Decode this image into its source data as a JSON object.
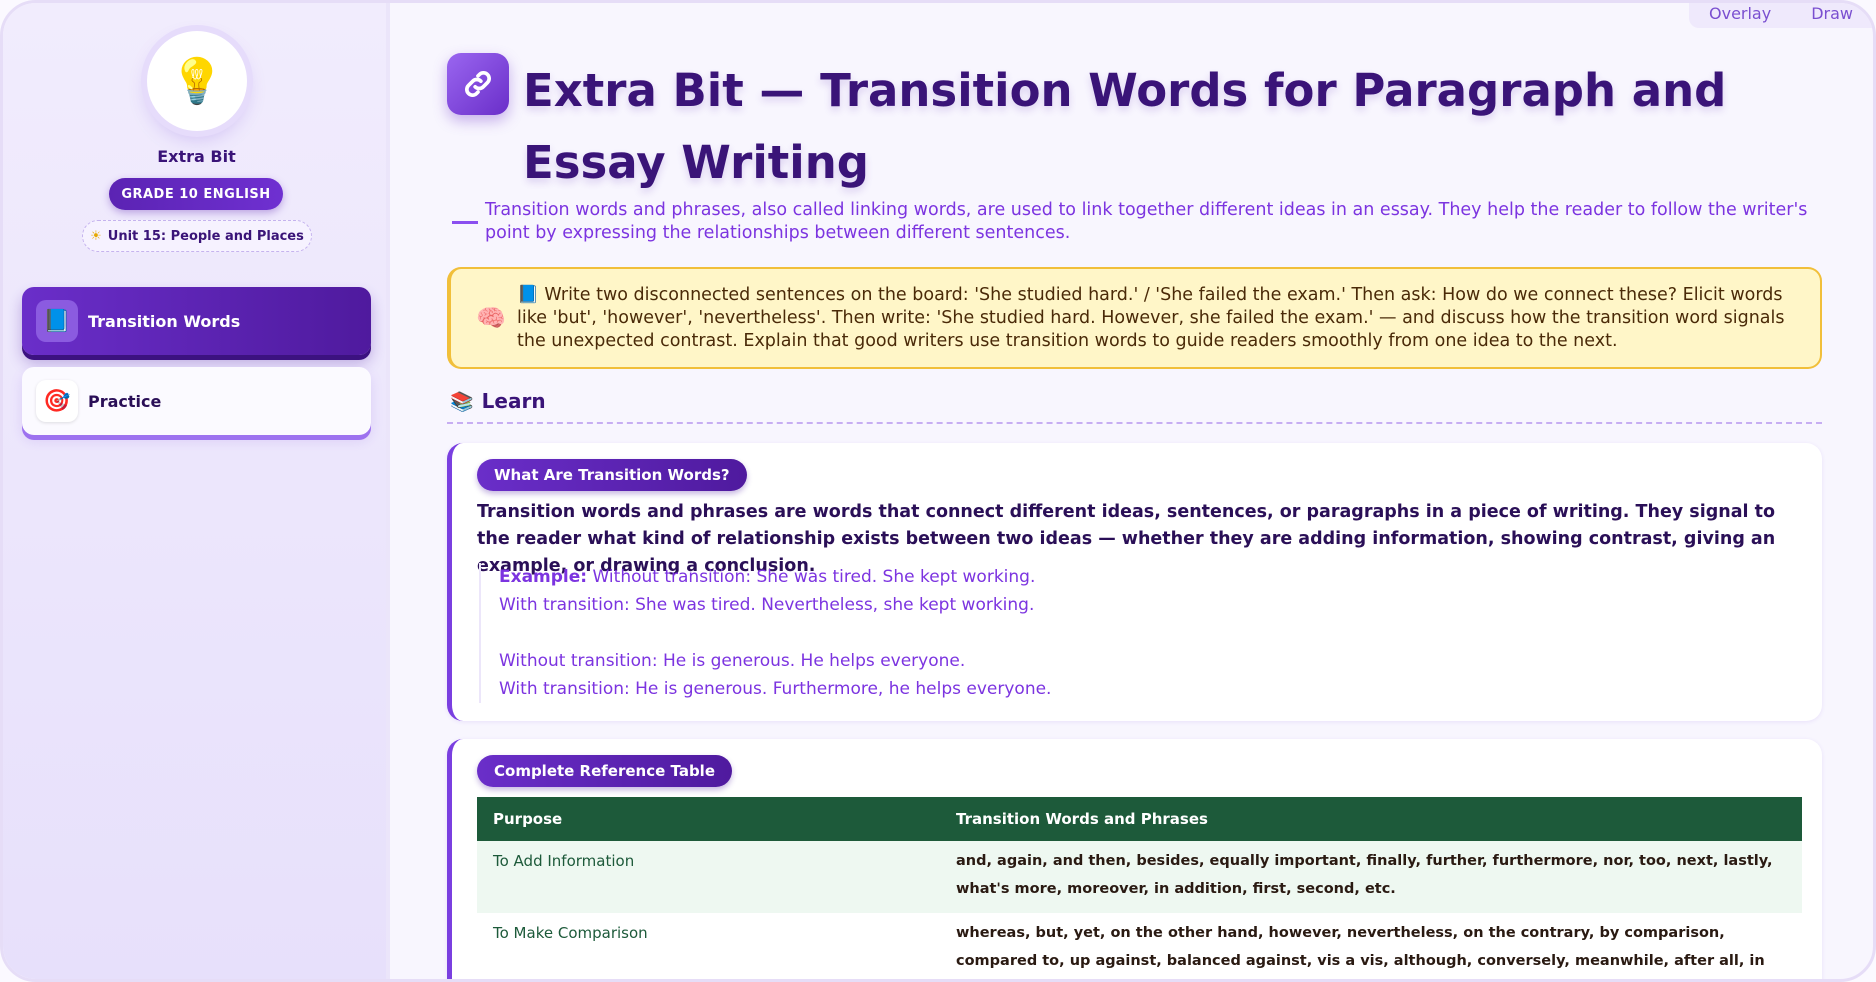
{
  "tools": {
    "overlay_label": "Overlay",
    "draw_label": "Draw"
  },
  "sidebar": {
    "logo_icon": "lightbulb-icon",
    "title": "Extra Bit",
    "grade": "GRADE 10 ENGLISH",
    "unit_icon": "☀",
    "unit": "Unit 15: People and Places",
    "items": [
      {
        "label": "Transition Words",
        "icon": "book-icon",
        "glyph": "📘",
        "active": true
      },
      {
        "label": "Practice",
        "icon": "target-icon",
        "glyph": "🎯",
        "active": false
      }
    ]
  },
  "main": {
    "title_icon": "link-icon",
    "title": "Extra Bit — Transition Words for Paragraph and Essay Writing",
    "subtitle": "Transition words and phrases, also called linking words, are used to link together different ideas in an essay. They help the reader to follow the writer's point by expressing the relationships between different sentences.",
    "teacher_note": "📘  Write two disconnected sentences on the board: 'She studied hard.' / 'She failed the exam.' Then ask: How do we connect these? Elicit words like 'but', 'however', 'nevertheless'. Then write: 'She studied hard. However, she failed the exam.' — and discuss how the transition word signals the unexpected contrast. Explain that good writers use transition words to guide readers smoothly from one idea to the next.",
    "learn_heading": "Learn",
    "card1": {
      "pill": "What Are Transition Words?",
      "body": "Transition words and phrases are words that connect different ideas, sentences, or paragraphs in a piece of writing. They signal to the reader what kind of relationship exists between two ideas — whether they are adding information, showing contrast, giving an example, or drawing a conclusion.",
      "example_label": "Example:",
      "example_lines": [
        "Without transition: She was tired. She kept working.",
        "With transition: She was tired. Nevertheless, she kept working.",
        "Without transition: He is generous. He helps everyone.",
        "With transition: He is generous. Furthermore, he helps everyone."
      ]
    },
    "card2": {
      "pill": "Complete Reference Table",
      "headers": [
        "Purpose",
        "Transition Words and Phrases"
      ],
      "rows": [
        {
          "purpose": "To Add Information",
          "words": "and, again, and then, besides, equally important, finally, further, furthermore, nor, too, next, lastly, what's more, moreover, in addition, first, second, etc."
        },
        {
          "purpose": "To Make Comparison",
          "words": "whereas, but, yet, on the other hand, however, nevertheless, on the contrary, by comparison, compared to, up against, balanced against, vis a vis, although, conversely, meanwhile, after all, in contrast, etc."
        }
      ]
    }
  }
}
